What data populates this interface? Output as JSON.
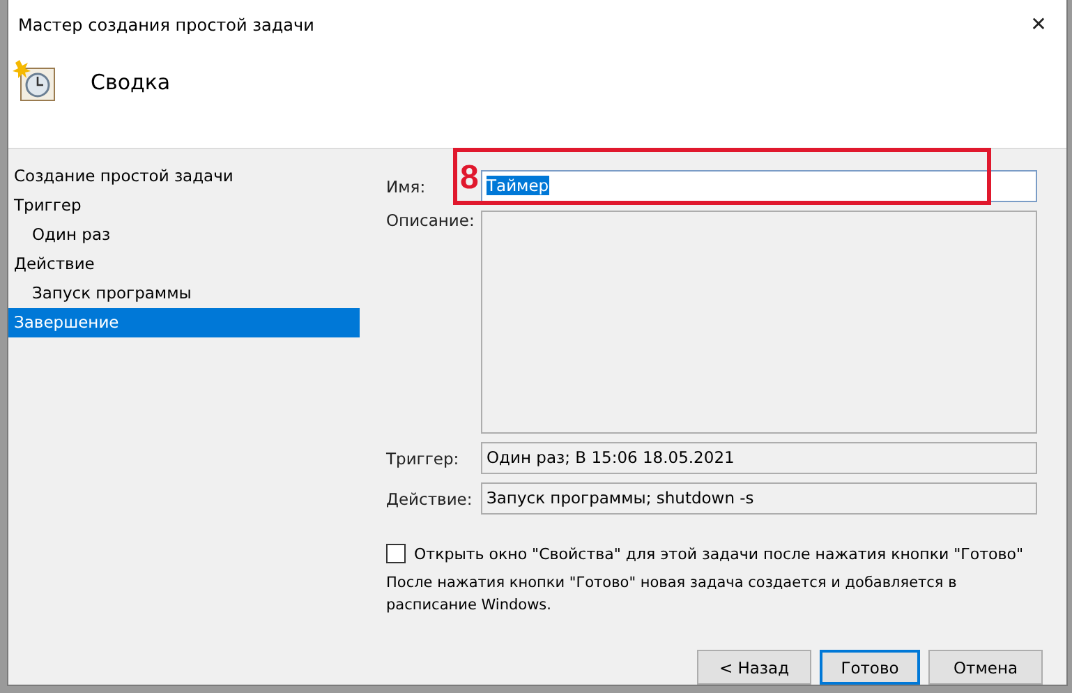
{
  "window": {
    "title": "Мастер создания простой задачи",
    "close": "✕"
  },
  "header": {
    "title": "Сводка"
  },
  "sidebar": {
    "items": [
      {
        "label": "Создание простой задачи",
        "selected": false
      },
      {
        "label": "Триггер",
        "selected": false,
        "children": [
          {
            "label": "Один раз",
            "selected": false
          }
        ]
      },
      {
        "label": "Действие",
        "selected": false,
        "children": [
          {
            "label": "Запуск программы",
            "selected": false
          }
        ]
      },
      {
        "label": "Завершение",
        "selected": true
      }
    ]
  },
  "form": {
    "name": {
      "label": "Имя:",
      "value": "Таймер",
      "text_selected": true
    },
    "description": {
      "label": "Описание:"
    },
    "trigger": {
      "label": "Триггер:",
      "value": "Один раз; В 15:06 18.05.2021"
    },
    "action": {
      "label": "Действие:",
      "value": "Запуск программы; shutdown -s"
    },
    "open_properties": {
      "label": "Открыть окно \"Свойства\" для этой задачи после нажатия кнопки \"Готово\"",
      "checked": false
    },
    "note": "После нажатия кнопки \"Готово\" новая задача создается и добавляется в расписание Windows."
  },
  "annotation": {
    "label": "8"
  },
  "buttons": [
    {
      "label": "< Назад",
      "default": false
    },
    {
      "label": "Готово",
      "default": true
    },
    {
      "label": "Отмена",
      "default": false
    }
  ]
}
